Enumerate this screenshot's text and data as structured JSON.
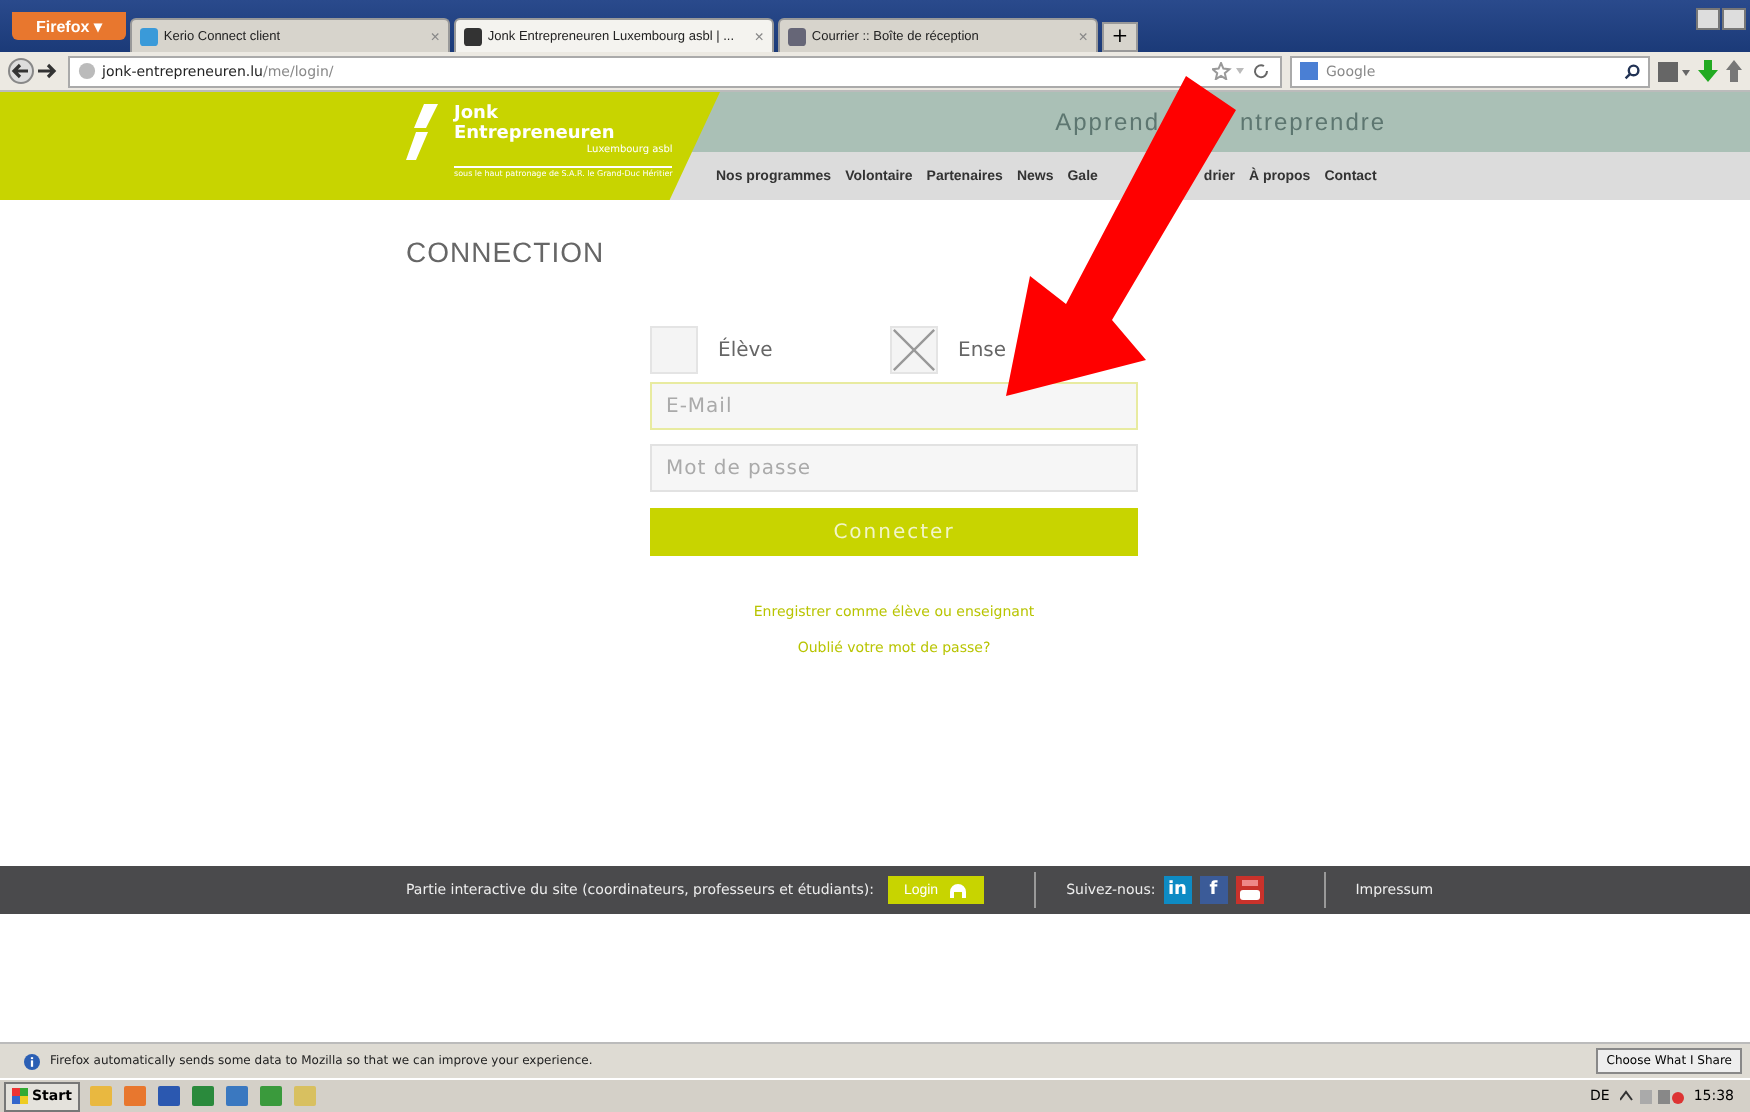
{
  "browser": {
    "menu_button": "Firefox ▾",
    "tabs": [
      {
        "title": "Kerio Connect client",
        "selected": false,
        "close": "×"
      },
      {
        "title": "Jonk Entrepreneuren Luxembourg asbl | ...",
        "selected": true,
        "close": "×"
      },
      {
        "title": "Courrier :: Boîte de réception",
        "selected": false,
        "close": "×"
      }
    ],
    "new_tab": "+",
    "url_domain": "jonk-entrepreneuren.lu",
    "url_path": "/me/login/",
    "search_placeholder": "Google"
  },
  "header": {
    "logo_title_1": "Jonk",
    "logo_title_2": "Entrepreneuren",
    "logo_subtitle": "Luxembourg asbl",
    "logo_patronage": "sous le haut patronage de S.A.R. le Grand-Duc Héritier",
    "tagline_parts": [
      "Apprend",
      "ntreprendre"
    ],
    "nav": [
      {
        "label": "Nos programmes"
      },
      {
        "label": "Volontaire"
      },
      {
        "label": "Partenaires"
      },
      {
        "label": "News"
      },
      {
        "label": "Gale"
      },
      {
        "label": "drier"
      },
      {
        "label": "À propos"
      },
      {
        "label": "Contact"
      }
    ]
  },
  "login": {
    "heading": "CONNECTION",
    "roles": [
      {
        "label": "Élève",
        "checked": false
      },
      {
        "label": "Ense",
        "checked": true
      }
    ],
    "email_placeholder": "E-Mail",
    "password_placeholder": "Mot de passe",
    "submit": "Connecter",
    "links": [
      "Enregistrer comme élève ou enseignant",
      "Oublié votre mot de passe?"
    ]
  },
  "footer": {
    "interactive_text": "Partie interactive du site (coordinateurs, professeurs et étudiants):",
    "login_button": "Login",
    "follow_text": "Suivez-nous:",
    "linkedin": "in",
    "facebook": "f",
    "impressum": "Impressum"
  },
  "notification": {
    "text": "Firefox automatically sends some data to Mozilla so that we can improve your experience.",
    "button": "Choose What I Share"
  },
  "taskbar": {
    "start": "Start",
    "language": "DE",
    "time": "15:38"
  }
}
